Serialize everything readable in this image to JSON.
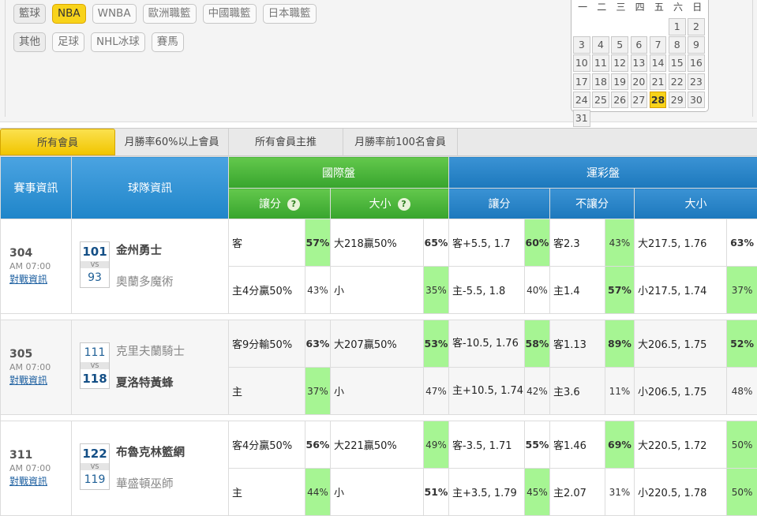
{
  "filters": {
    "row1": {
      "label": "籃球",
      "items": [
        "NBA",
        "WNBA",
        "歐洲職籃",
        "中國職籃",
        "日本職籃"
      ],
      "active": "NBA"
    },
    "row2": {
      "label": "其他",
      "items": [
        "足球",
        "NHL冰球",
        "賽馬"
      ]
    }
  },
  "calendar": {
    "weekdays": [
      "一",
      "二",
      "三",
      "四",
      "五",
      "六",
      "日"
    ],
    "leading_blanks": 5,
    "days": [
      "1",
      "2",
      "3",
      "4",
      "5",
      "6",
      "7",
      "8",
      "9",
      "10",
      "11",
      "12",
      "13",
      "14",
      "15",
      "16",
      "17",
      "18",
      "19",
      "20",
      "21",
      "22",
      "23",
      "24",
      "25",
      "26",
      "27",
      "28",
      "29",
      "30",
      "31"
    ],
    "today": "28"
  },
  "tabs": [
    "所有會員",
    "月勝率60%以上會員",
    "所有會員主推",
    "月勝率前100名會員"
  ],
  "active_tab": 0,
  "headers": {
    "game_info": "賽事資訊",
    "team_info": "球隊資訊",
    "intl": "國際盤",
    "sport_lottery": "運彩盤",
    "handicap": "讓分",
    "over_under": "大小",
    "lottery_handicap": "讓分",
    "no_handicap": "不讓分",
    "lottery_ou": "大小",
    "qmark": "?"
  },
  "vs_label": "VS",
  "games": [
    {
      "code": "304",
      "time": "AM 07:00",
      "link": "對戰資訊",
      "away": {
        "score": "101",
        "name": "金州勇士",
        "bold": true
      },
      "home": {
        "score": "93",
        "name": "奧蘭多魔術",
        "bold": false
      },
      "rows": [
        {
          "h": "客",
          "hp": "57%",
          "ou": "大218贏50%",
          "oup": "65%",
          "lh": "客+5.5, 1.7",
          "lhp": "60%",
          "nh": "客2.3",
          "nhp": "43%",
          "lou": "大217.5, 1.76",
          "loup": "63%"
        },
        {
          "h": "主4分贏50%",
          "hp": "43%",
          "ou": "小",
          "oup": "35%",
          "lh": "主-5.5, 1.8",
          "lhp": "40%",
          "nh": "主1.4",
          "nhp": "57%",
          "lou": "小217.5, 1.74",
          "loup": "37%"
        }
      ]
    },
    {
      "code": "305",
      "time": "AM 07:00",
      "link": "對戰資訊",
      "away": {
        "score": "111",
        "name": "克里夫蘭騎士",
        "bold": false
      },
      "home": {
        "score": "118",
        "name": "夏洛特黃蜂",
        "bold": true
      },
      "rows": [
        {
          "h": "客9分輸50%",
          "hp": "63%",
          "ou": "大207贏50%",
          "oup": "53%",
          "lh": "客-10.5, 1.76",
          "lhp": "58%",
          "nh": "客1.13",
          "nhp": "89%",
          "lou": "大206.5, 1.75",
          "loup": "52%"
        },
        {
          "h": "主",
          "hp": "37%",
          "ou": "小",
          "oup": "47%",
          "lh": "主+10.5, 1.74",
          "lhp": "42%",
          "nh": "主3.6",
          "nhp": "11%",
          "lou": "小206.5, 1.75",
          "loup": "48%"
        }
      ]
    },
    {
      "code": "311",
      "time": "AM 07:00",
      "link": "對戰資訊",
      "away": {
        "score": "122",
        "name": "布魯克林籃網",
        "bold": true
      },
      "home": {
        "score": "119",
        "name": "華盛頓巫師",
        "bold": false
      },
      "rows": [
        {
          "h": "客4分贏50%",
          "hp": "56%",
          "ou": "大221贏50%",
          "oup": "49%",
          "lh": "客-3.5, 1.71",
          "lhp": "55%",
          "nh": "客1.46",
          "nhp": "69%",
          "lou": "大220.5, 1.72",
          "loup": "50%"
        },
        {
          "h": "主",
          "hp": "44%",
          "ou": "小",
          "oup": "51%",
          "lh": "主+3.5, 1.79",
          "lhp": "45%",
          "nh": "主2.07",
          "nhp": "31%",
          "lou": "小220.5, 1.78",
          "loup": "50%"
        }
      ]
    }
  ],
  "highlights": [
    {
      "hp": [
        0
      ],
      "oup": [
        1
      ],
      "lhp": [
        0
      ],
      "nhp": [
        0,
        1
      ],
      "loup": [
        1
      ]
    },
    {
      "hp": [
        1
      ],
      "oup": [
        0
      ],
      "lhp": [
        0
      ],
      "nhp": [
        0
      ],
      "loup": [
        0
      ]
    },
    {
      "hp": [
        1
      ],
      "oup": [
        0
      ],
      "lhp": [
        1
      ],
      "nhp": [
        0
      ],
      "loup": [
        0,
        1
      ]
    }
  ],
  "bolds": [
    {
      "hp": [
        0
      ],
      "oup": [
        0
      ],
      "lhp": [
        0
      ],
      "nhp": [
        1
      ],
      "loup": [
        0
      ]
    },
    {
      "hp": [
        0
      ],
      "oup": [
        0
      ],
      "lhp": [
        0
      ],
      "nhp": [
        0
      ],
      "loup": [
        0
      ]
    },
    {
      "hp": [
        0
      ],
      "oup": [
        1
      ],
      "lhp": [
        0
      ],
      "nhp": [
        0
      ],
      "loup": []
    }
  ]
}
